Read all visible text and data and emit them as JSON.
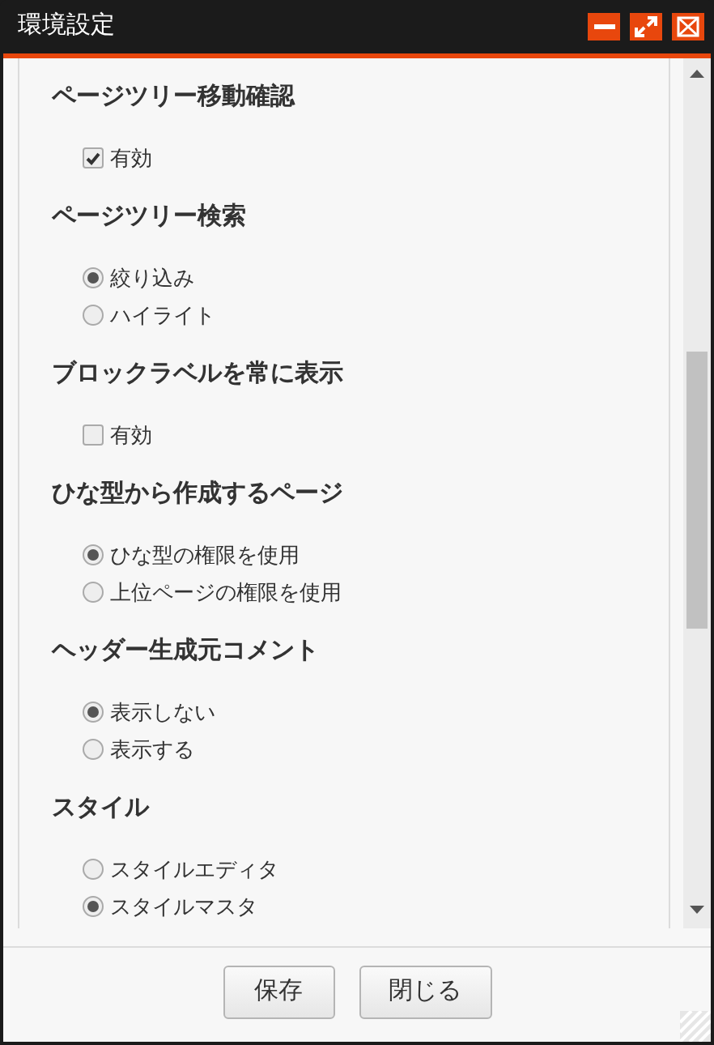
{
  "window": {
    "title": "環境設定"
  },
  "sections": [
    {
      "title": "ページツリー移動確認",
      "kind": "checkbox",
      "options": [
        {
          "label": "有効",
          "checked": true
        }
      ]
    },
    {
      "title": "ページツリー検索",
      "kind": "radio",
      "options": [
        {
          "label": "絞り込み",
          "selected": true
        },
        {
          "label": "ハイライト",
          "selected": false
        }
      ]
    },
    {
      "title": "ブロックラベルを常に表示",
      "kind": "checkbox",
      "options": [
        {
          "label": "有効",
          "checked": false
        }
      ]
    },
    {
      "title": "ひな型から作成するページ",
      "kind": "radio",
      "options": [
        {
          "label": "ひな型の権限を使用",
          "selected": true
        },
        {
          "label": "上位ページの権限を使用",
          "selected": false
        }
      ]
    },
    {
      "title": "ヘッダー生成元コメント",
      "kind": "radio",
      "options": [
        {
          "label": "表示しない",
          "selected": true
        },
        {
          "label": "表示する",
          "selected": false
        }
      ]
    },
    {
      "title": "スタイル",
      "kind": "radio",
      "options": [
        {
          "label": "スタイルエディタ",
          "selected": false
        },
        {
          "label": "スタイルマスタ",
          "selected": true
        }
      ]
    }
  ],
  "buttons": [
    "保存",
    "閉じる"
  ]
}
